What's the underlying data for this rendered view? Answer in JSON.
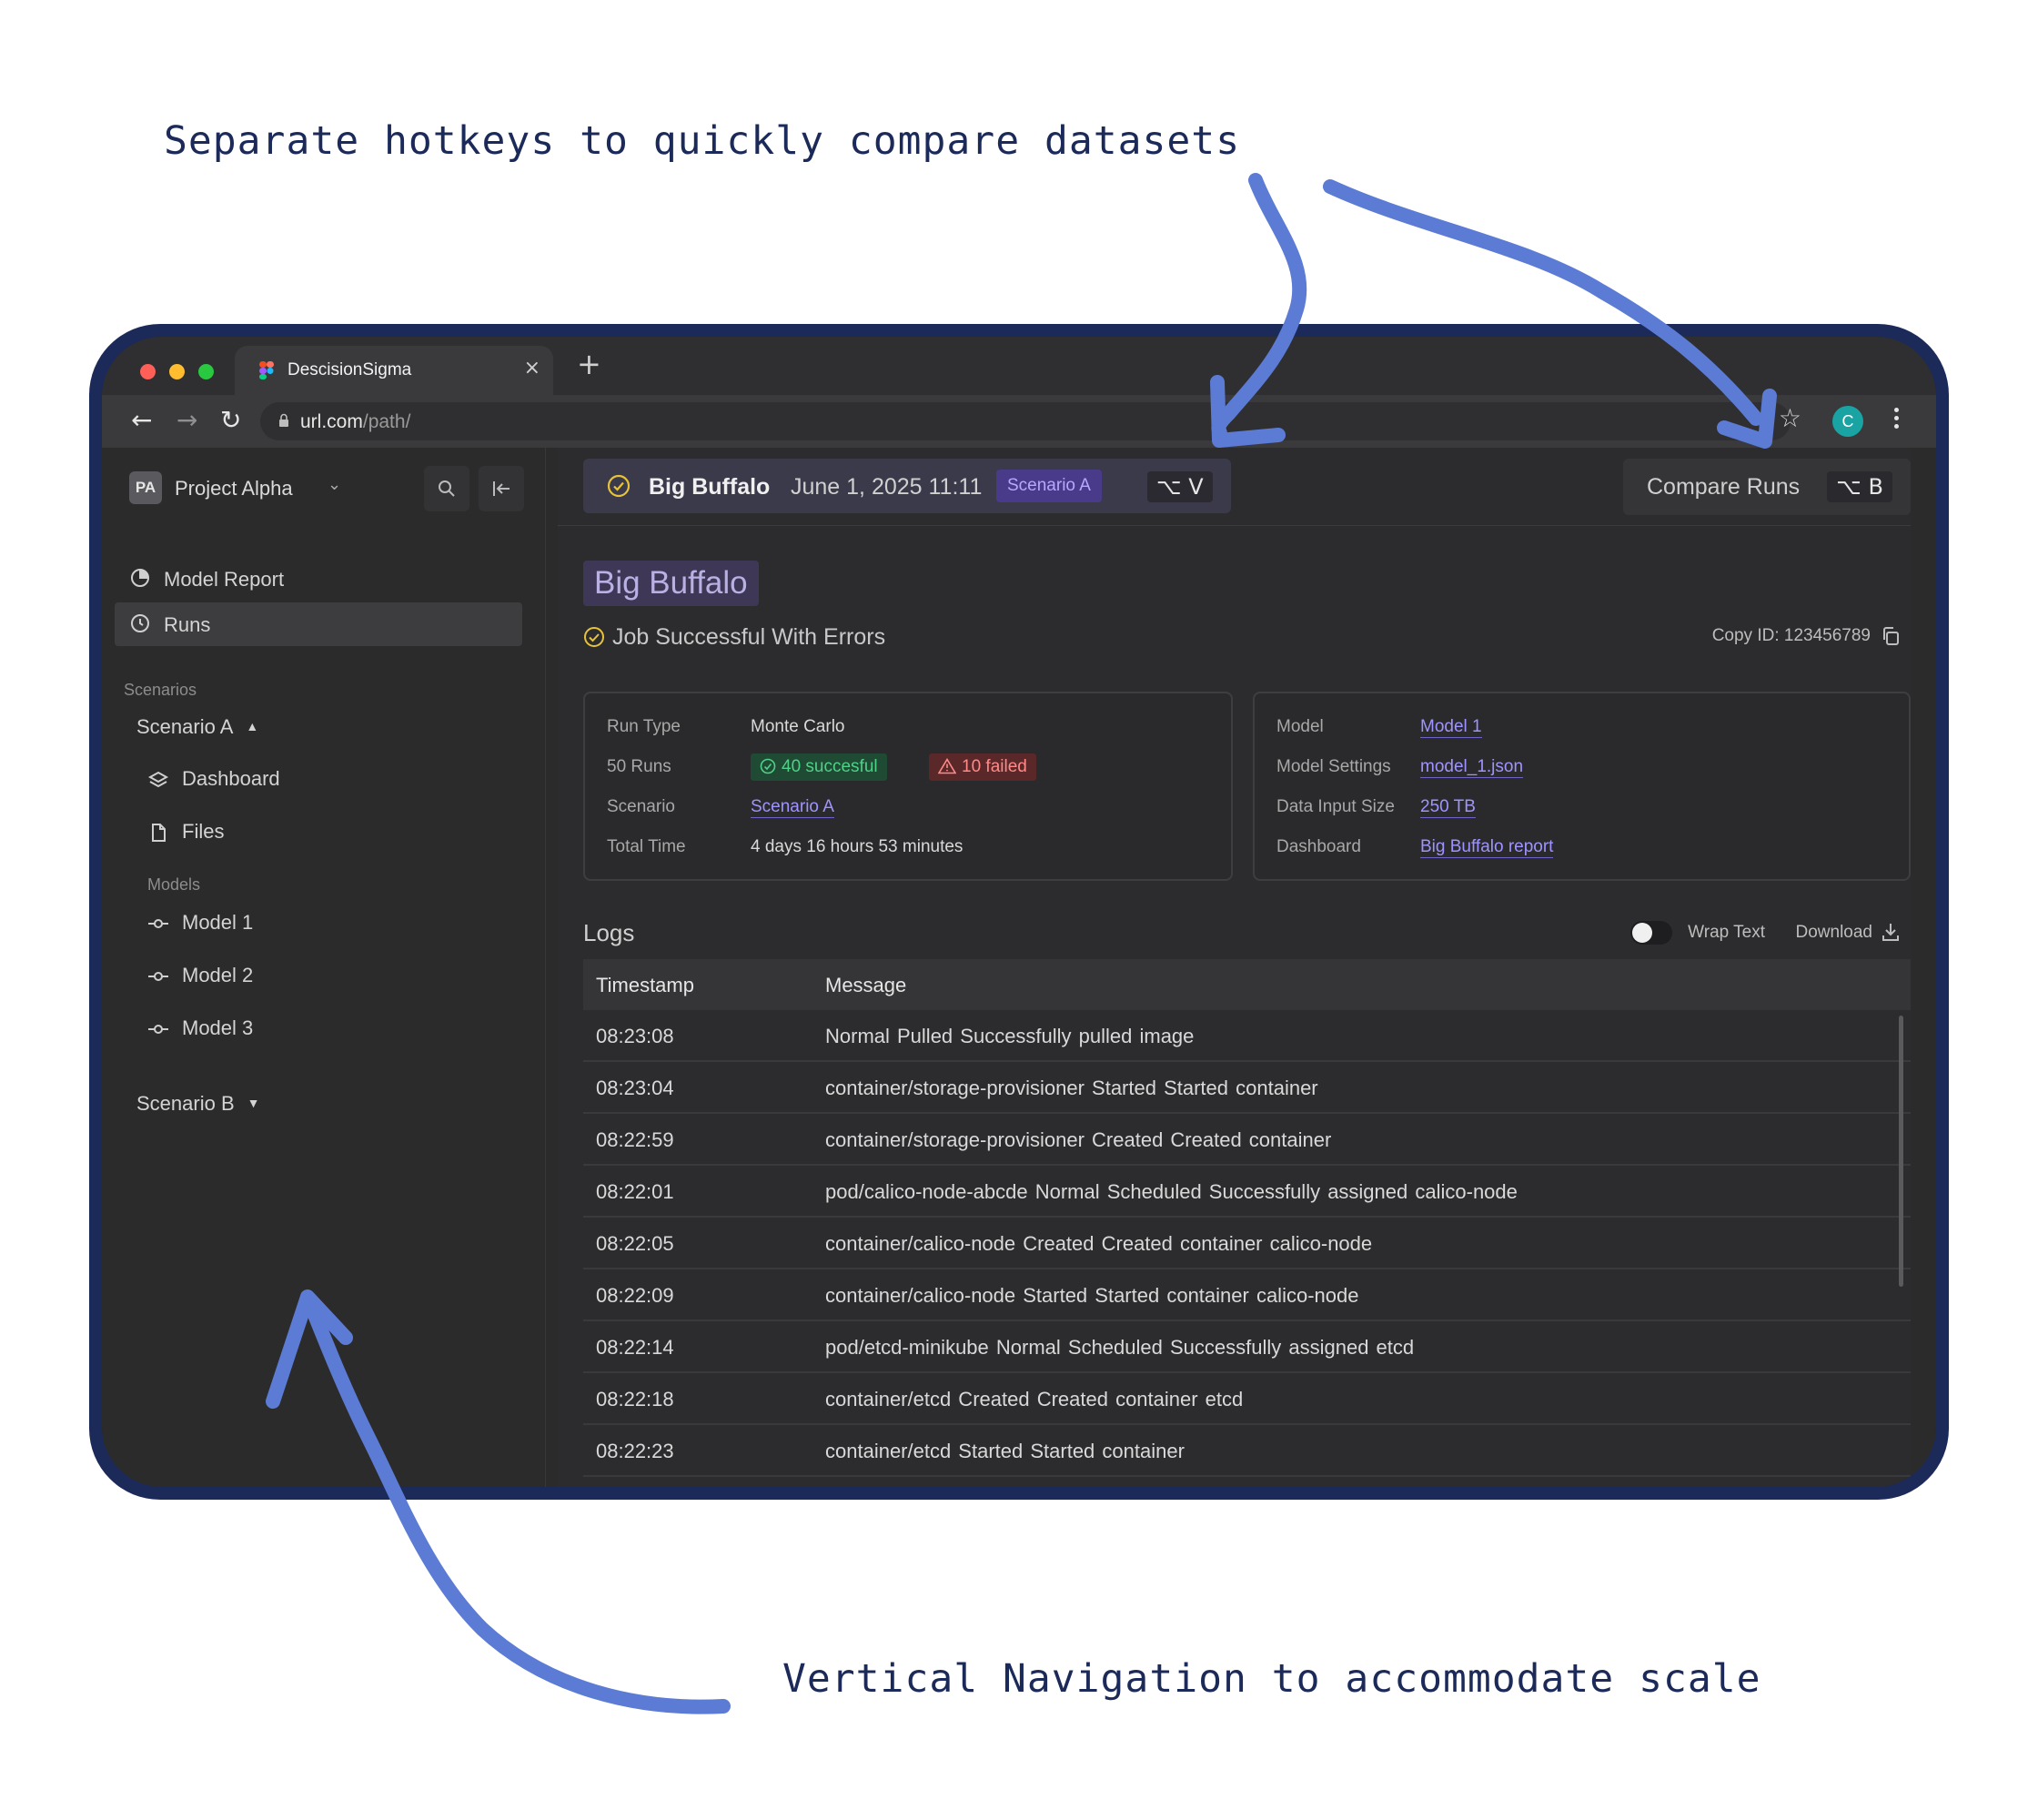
{
  "annotations": {
    "top": "Separate hotkeys to quickly compare datasets",
    "bottom": "Vertical Navigation to accommodate scale"
  },
  "browser": {
    "tab_title": "DescisionSigma",
    "tab_close": "×",
    "new_tab": "+",
    "url_host": "url.com",
    "url_path": "/path/",
    "profile_initial": "C"
  },
  "sidebar": {
    "project_initials": "PA",
    "project_name": "Project Alpha",
    "nav": [
      {
        "label": "Model Report",
        "icon": "pie-chart-icon"
      },
      {
        "label": "Runs",
        "icon": "clock-icon",
        "active": true
      }
    ],
    "scenarios_label": "Scenarios",
    "scenario_a": {
      "label": "Scenario A",
      "items": [
        {
          "label": "Dashboard",
          "icon": "layers-icon"
        },
        {
          "label": "Files",
          "icon": "file-icon"
        }
      ],
      "models_label": "Models",
      "models": [
        "Model 1",
        "Model 2",
        "Model 3"
      ]
    },
    "scenario_b": {
      "label": "Scenario B"
    }
  },
  "main": {
    "run_tab": {
      "name": "Big Buffalo",
      "date": "June 1, 2025 11:11",
      "badge": "Scenario A",
      "hotkey": "⌥ V"
    },
    "compare": {
      "label": "Compare Runs",
      "hotkey": "⌥ B"
    },
    "title": "Big Buffalo",
    "status": "Job Successful With Errors",
    "copy_id": "Copy ID: 123456789",
    "run_info": {
      "run_type_label": "Run Type",
      "run_type": "Monte Carlo",
      "runs_label": "50 Runs",
      "successful": "40 succesful",
      "failed": "10 failed",
      "scenario_label": "Scenario",
      "scenario": "Scenario A",
      "total_time_label": "Total Time",
      "total_time": "4 days 16 hours 53 minutes"
    },
    "model_info": {
      "model_label": "Model",
      "model": "Model 1",
      "settings_label": "Model Settings",
      "settings": "model_1.json",
      "input_size_label": "Data Input Size",
      "input_size": "250 TB",
      "dashboard_label": "Dashboard",
      "dashboard": "Big Buffalo report"
    },
    "logs": {
      "title": "Logs",
      "wrap_text": "Wrap Text",
      "wrap_on": false,
      "download": "Download",
      "columns": [
        "Timestamp",
        "Message"
      ],
      "rows": [
        [
          "08:23:08",
          "Normal  Pulled  Successfully pulled image"
        ],
        [
          "08:23:04",
          "container/storage-provisioner  Started  Started container"
        ],
        [
          "08:22:59",
          "container/storage-provisioner  Created  Created container"
        ],
        [
          "08:22:01",
          "pod/calico-node-abcde  Normal  Scheduled  Successfully assigned calico-node"
        ],
        [
          "08:22:05",
          "container/calico-node  Created  Created container calico-node"
        ],
        [
          "08:22:09",
          "container/calico-node  Started  Started container calico-node"
        ],
        [
          "08:22:14",
          "pod/etcd-minikube  Normal  Scheduled  Successfully assigned etcd"
        ],
        [
          "08:22:18",
          "container/etcd  Created  Created container etcd"
        ],
        [
          "08:22:23",
          "container/etcd  Started  Started container"
        ]
      ]
    }
  },
  "colors": {
    "annotation_ink": "#1c2a5a",
    "arrow": "#5b7bd5",
    "device_frame": "#1c2a5a",
    "accent_purple": "#9f94ff",
    "success_green": "#4fd188",
    "fail_red": "#ff8a8a",
    "status_yellow": "#e8c33a"
  }
}
